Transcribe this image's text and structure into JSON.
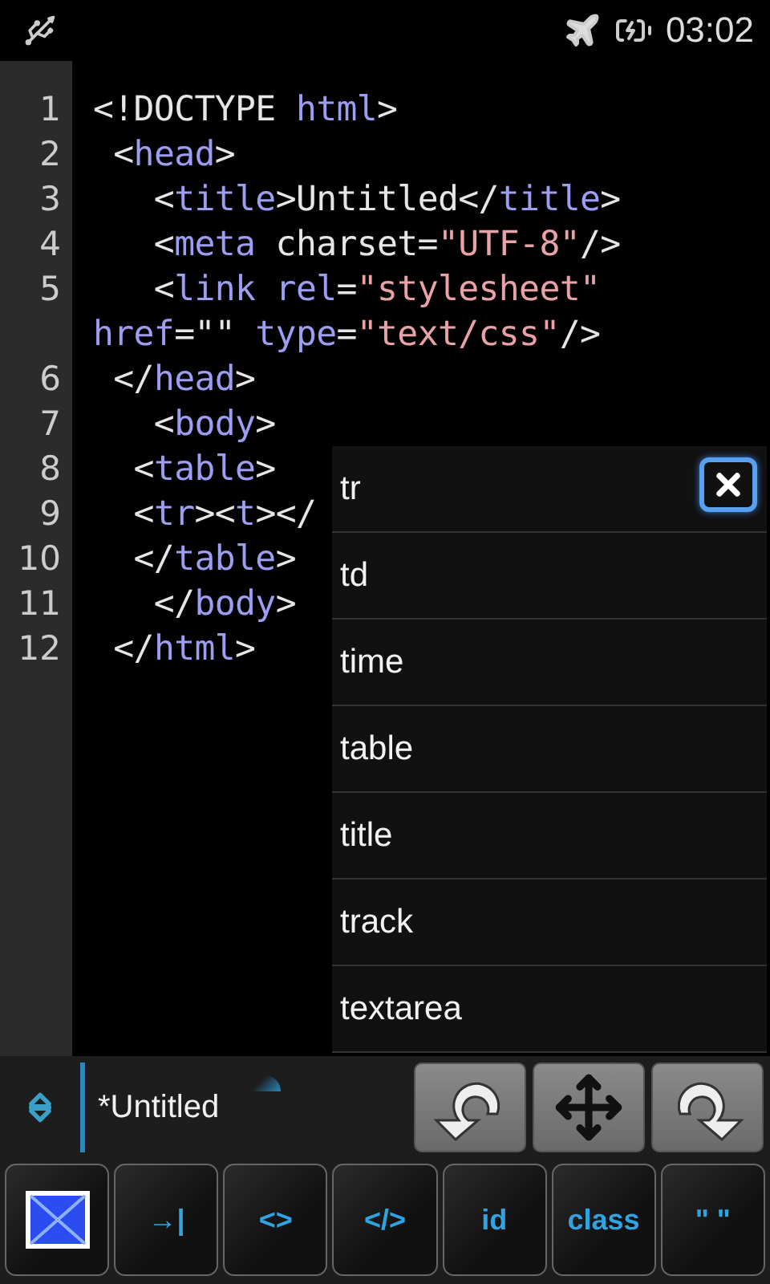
{
  "status_bar": {
    "time": "03:02"
  },
  "editor": {
    "lines": [
      {
        "number": "1",
        "tokens": [
          {
            "kind": "punct",
            "text": "<!DOCTYPE "
          },
          {
            "kind": "name",
            "text": "html"
          },
          {
            "kind": "punct",
            "text": ">"
          }
        ]
      },
      {
        "number": "2",
        "tokens": [
          {
            "kind": "punct",
            "text": " <"
          },
          {
            "kind": "name",
            "text": "head"
          },
          {
            "kind": "punct",
            "text": ">"
          }
        ]
      },
      {
        "number": "3",
        "tokens": [
          {
            "kind": "punct",
            "text": "   <"
          },
          {
            "kind": "name",
            "text": "title"
          },
          {
            "kind": "punct",
            "text": ">Untitled</"
          },
          {
            "kind": "name",
            "text": "title"
          },
          {
            "kind": "punct",
            "text": ">"
          }
        ]
      },
      {
        "number": "4",
        "tokens": [
          {
            "kind": "punct",
            "text": "   <"
          },
          {
            "kind": "name",
            "text": "meta"
          },
          {
            "kind": "punct",
            "text": " charset="
          },
          {
            "kind": "string",
            "text": "\"UTF-8\""
          },
          {
            "kind": "punct",
            "text": "/>"
          }
        ]
      },
      {
        "number": "5",
        "tokens": [
          {
            "kind": "punct",
            "text": "   <"
          },
          {
            "kind": "name",
            "text": "link rel"
          },
          {
            "kind": "punct",
            "text": "="
          },
          {
            "kind": "string",
            "text": "\"stylesheet\""
          }
        ]
      },
      {
        "tokens": [
          {
            "kind": "name",
            "text": "href"
          },
          {
            "kind": "punct",
            "text": "=\"\" "
          },
          {
            "kind": "name",
            "text": "type"
          },
          {
            "kind": "punct",
            "text": "="
          },
          {
            "kind": "string",
            "text": "\"text/css\""
          },
          {
            "kind": "punct",
            "text": "/>"
          }
        ]
      },
      {
        "number": "6",
        "tokens": [
          {
            "kind": "punct",
            "text": " </"
          },
          {
            "kind": "name",
            "text": "head"
          },
          {
            "kind": "punct",
            "text": ">"
          }
        ]
      },
      {
        "number": "7",
        "tokens": [
          {
            "kind": "punct",
            "text": "   <"
          },
          {
            "kind": "name",
            "text": "body"
          },
          {
            "kind": "punct",
            "text": ">"
          }
        ]
      },
      {
        "number": "8",
        "tokens": [
          {
            "kind": "punct",
            "text": "  <"
          },
          {
            "kind": "name",
            "text": "table"
          },
          {
            "kind": "punct",
            "text": ">"
          }
        ]
      },
      {
        "number": "9",
        "tokens": [
          {
            "kind": "punct",
            "text": "  <"
          },
          {
            "kind": "name",
            "text": "tr"
          },
          {
            "kind": "punct",
            "text": "><"
          },
          {
            "kind": "name",
            "text": "t"
          },
          {
            "kind": "punct",
            "text": "></"
          }
        ]
      },
      {
        "number": "10",
        "tokens": [
          {
            "kind": "punct",
            "text": "  </"
          },
          {
            "kind": "name",
            "text": "table"
          },
          {
            "kind": "punct",
            "text": ">"
          }
        ]
      },
      {
        "number": "11",
        "tokens": [
          {
            "kind": "punct",
            "text": "   </"
          },
          {
            "kind": "name",
            "text": "body"
          },
          {
            "kind": "punct",
            "text": ">"
          }
        ]
      },
      {
        "number": "12",
        "tokens": [
          {
            "kind": "punct",
            "text": " </"
          },
          {
            "kind": "name",
            "text": "html"
          },
          {
            "kind": "punct",
            "text": ">"
          }
        ]
      }
    ]
  },
  "autocomplete": {
    "items": [
      "tr",
      "td",
      "time",
      "table",
      "title",
      "track",
      "textarea"
    ]
  },
  "file_tab": {
    "title": "*Untitled"
  },
  "keys": [
    {
      "kind": "image"
    },
    {
      "kind": "text",
      "label": "→|"
    },
    {
      "kind": "text",
      "label": "<>"
    },
    {
      "kind": "text",
      "label": "</>"
    },
    {
      "kind": "text",
      "label": "id"
    },
    {
      "kind": "text",
      "label": "class"
    },
    {
      "kind": "text",
      "label": "\" \""
    }
  ]
}
